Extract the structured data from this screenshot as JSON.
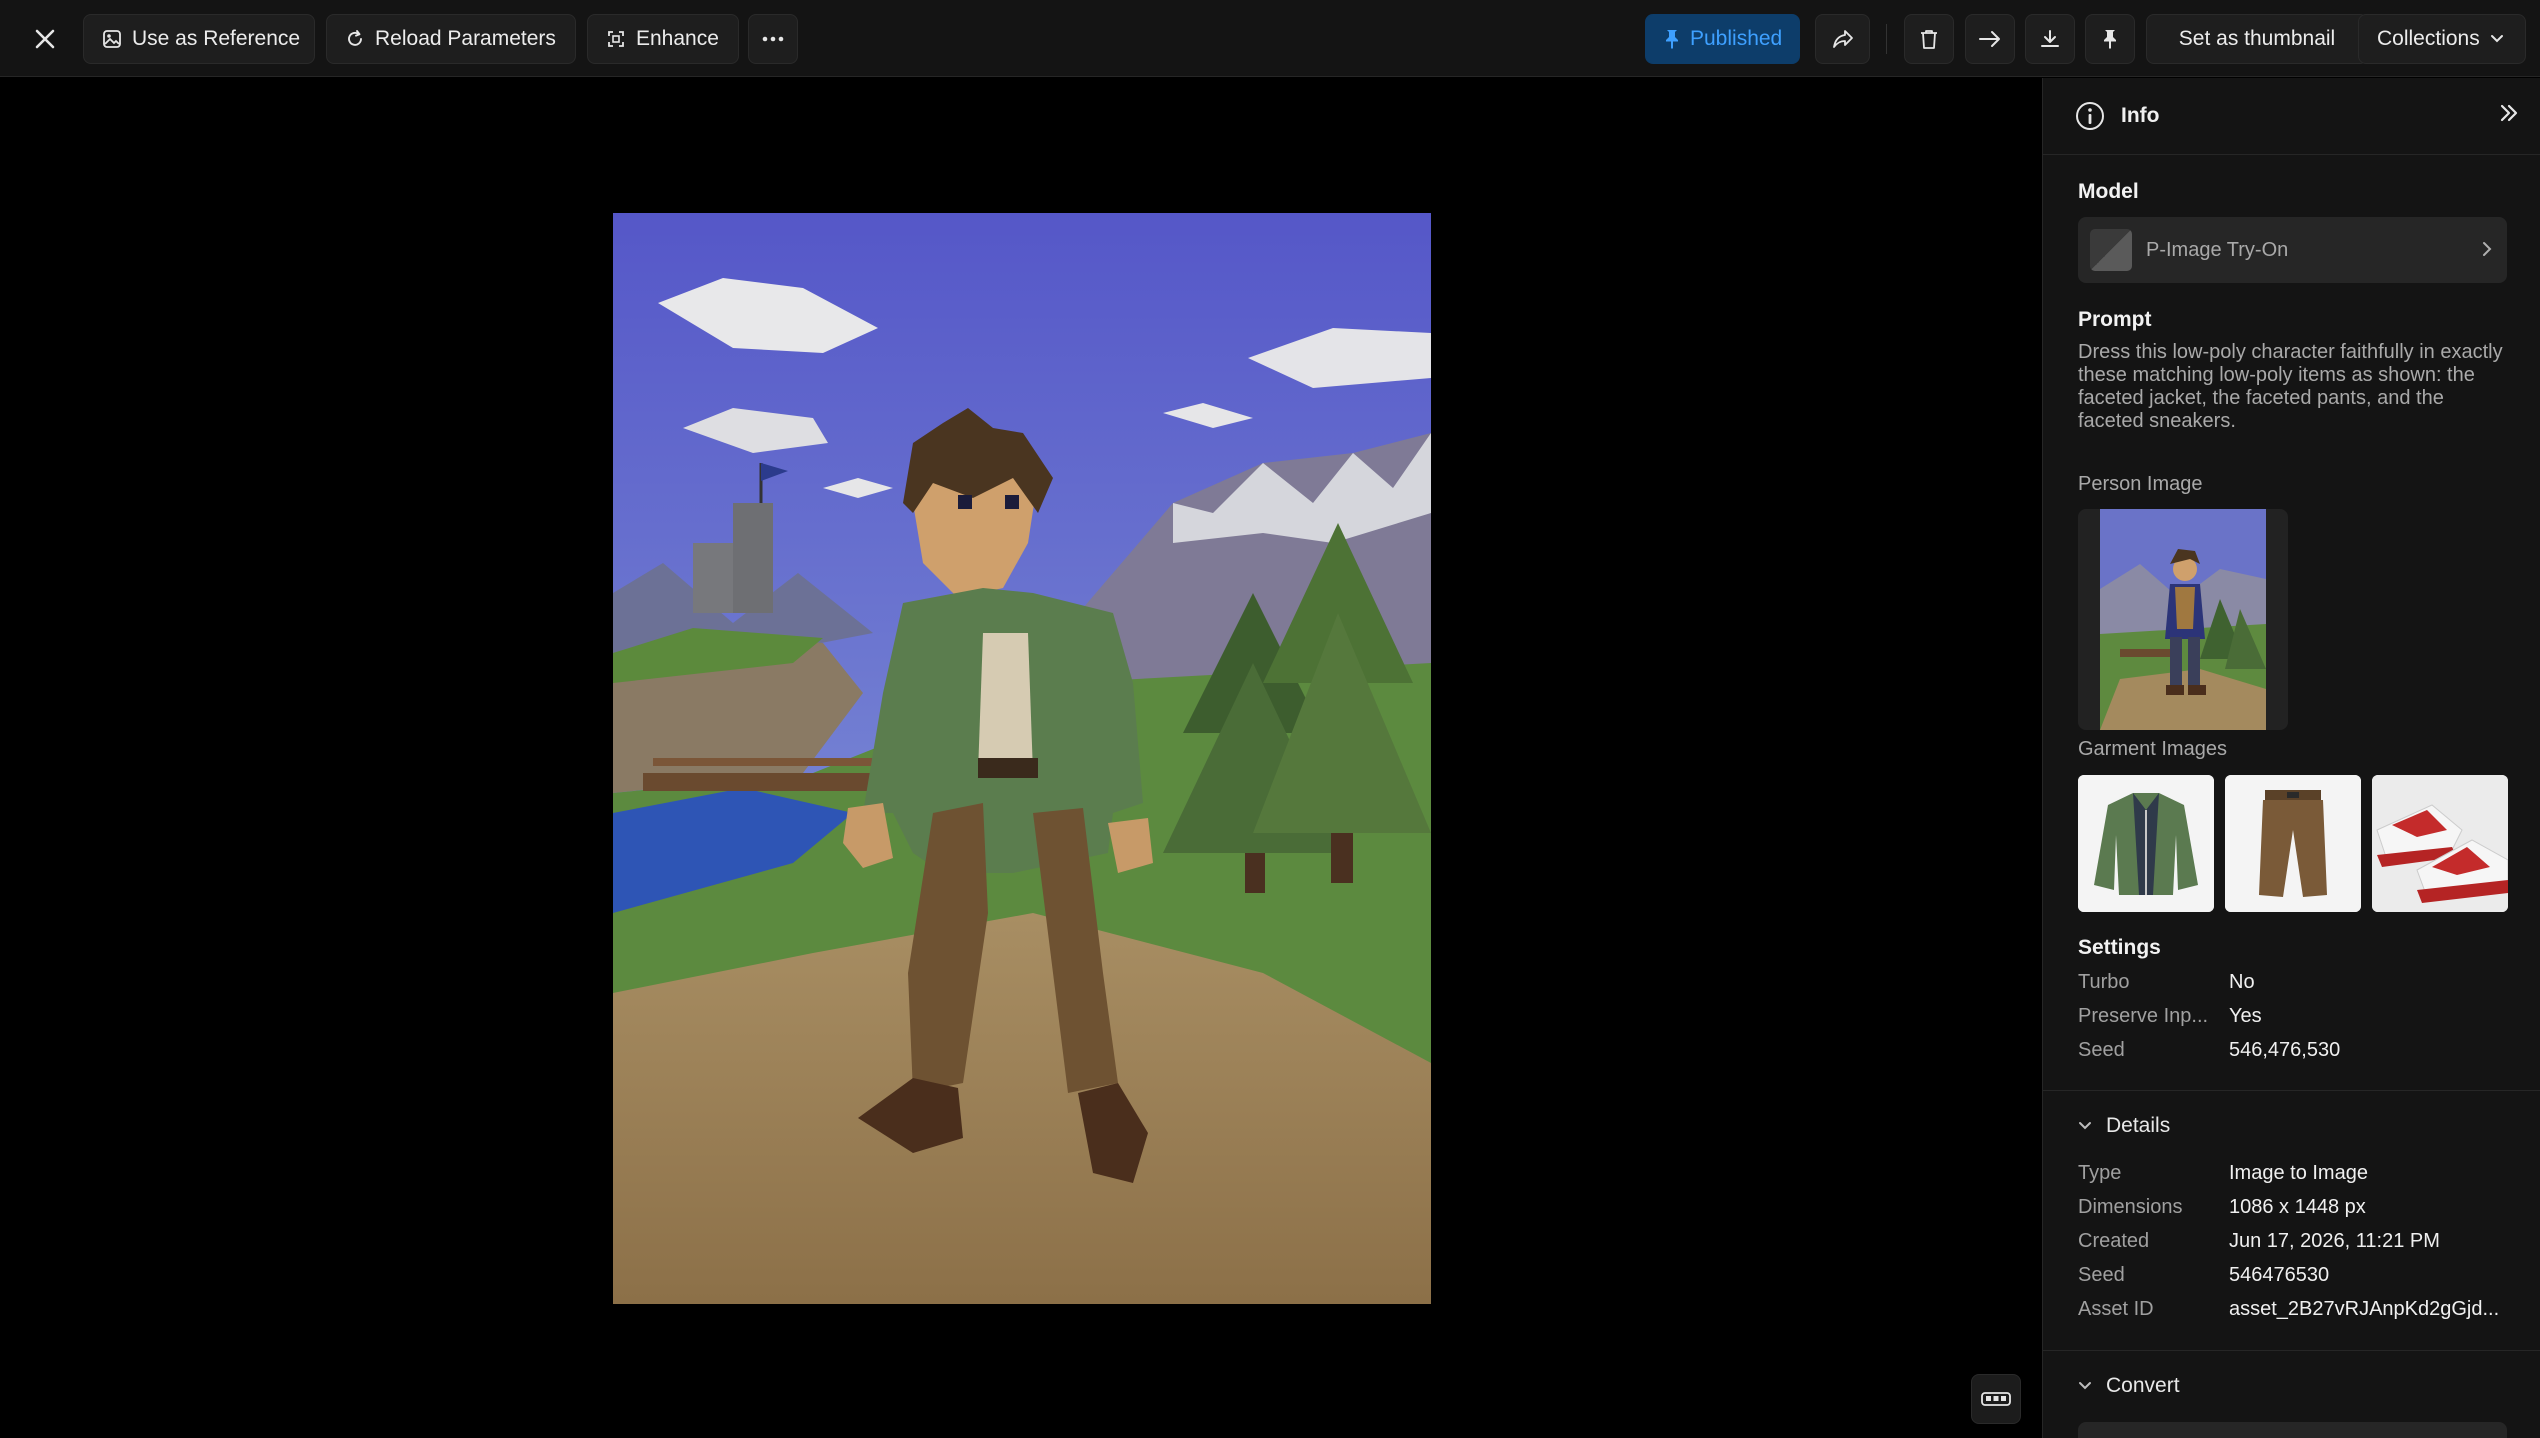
{
  "toolbar": {
    "use_as_reference": "Use as Reference",
    "reload_parameters": "Reload Parameters",
    "enhance": "Enhance",
    "published": "Published",
    "set_as_thumbnail": "Set as thumbnail",
    "collections": "Collections"
  },
  "panel": {
    "title": "Info",
    "model_label": "Model",
    "model_name": "P-Image Try-On",
    "prompt_label": "Prompt",
    "prompt_text": "Dress this low-poly character faithfully in exactly these matching low-poly items as shown: the faceted jacket, the faceted pants, and the faceted sneakers.",
    "person_image_label": "Person Image",
    "garment_images_label": "Garment Images",
    "settings_label": "Settings",
    "settings": [
      {
        "key": "Turbo",
        "value": "No"
      },
      {
        "key": "Preserve Inp...",
        "value": "Yes"
      },
      {
        "key": "Seed",
        "value": "546,476,530"
      }
    ],
    "details_label": "Details",
    "details": [
      {
        "key": "Type",
        "value": "Image to Image"
      },
      {
        "key": "Dimensions",
        "value": "1086 x 1448 px"
      },
      {
        "key": "Created",
        "value": "Jun 17, 2026, 11:21 PM"
      },
      {
        "key": "Seed",
        "value": "546476530"
      },
      {
        "key": "Asset ID",
        "value": "asset_2B27vRJAnpKd2gGjd..."
      }
    ],
    "convert_label": "Convert"
  },
  "colors": {
    "published_bg": "#0d3d6a",
    "published_text": "#3ea0ff",
    "panel_bg": "#141414"
  }
}
